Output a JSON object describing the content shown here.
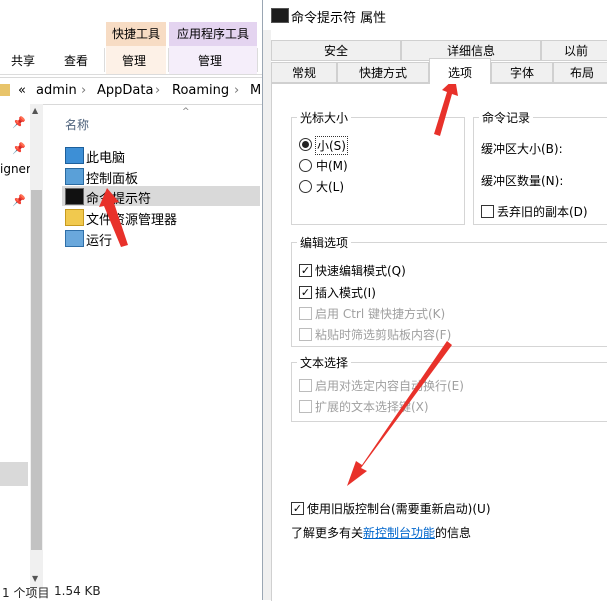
{
  "explorer": {
    "ribbon": {
      "context_tab_shortcut": "快捷工具",
      "context_tab_app": "应用程序工具",
      "share": "共享",
      "view": "查看",
      "manage_1": "管理",
      "manage_2": "管理"
    },
    "address": {
      "chevron": "«",
      "parts": [
        "admin",
        "AppData",
        "Roaming",
        "M"
      ],
      "separator": "›"
    },
    "nav_fragment": "igner",
    "column_header": "名称",
    "files": [
      {
        "name": "此电脑",
        "icon": "computer-icon"
      },
      {
        "name": "控制面板",
        "icon": "control-panel-icon"
      },
      {
        "name": "命令提示符",
        "icon": "cmd-icon",
        "selected": true
      },
      {
        "name": "文件资源管理器",
        "icon": "folder-icon"
      },
      {
        "name": "运行",
        "icon": "run-icon"
      }
    ],
    "status": {
      "count": "1 个项目",
      "size": "1.54 KB"
    }
  },
  "dialog": {
    "title": "命令提示符 属性",
    "tabs_row1": [
      "安全",
      "详细信息",
      "以前"
    ],
    "tabs_row2": [
      "常规",
      "快捷方式",
      "选项",
      "字体",
      "布局"
    ],
    "active_tab": "选项",
    "cursor_size": {
      "title": "光标大小",
      "options": [
        {
          "label": "小(S)",
          "checked": true
        },
        {
          "label": "中(M)",
          "checked": false
        },
        {
          "label": "大(L)",
          "checked": false
        }
      ]
    },
    "command_history": {
      "title": "命令记录",
      "buffer_size": "缓冲区大小(B):",
      "buffer_count": "缓冲区数量(N):",
      "discard_old": "丢弃旧的副本(D)",
      "discard_checked": false
    },
    "edit_options": {
      "title": "编辑选项",
      "items": [
        {
          "label": "快速编辑模式(Q)",
          "checked": true,
          "enabled": true
        },
        {
          "label": "插入模式(I)",
          "checked": true,
          "enabled": true
        },
        {
          "label": "启用 Ctrl 键快捷方式(K)",
          "checked": false,
          "enabled": false
        },
        {
          "label": "粘贴时筛选剪贴板内容(F)",
          "checked": false,
          "enabled": false
        }
      ]
    },
    "text_selection": {
      "title": "文本选择",
      "items": [
        {
          "label": "启用对选定内容自动换行(E)",
          "checked": false,
          "enabled": false
        },
        {
          "label": "扩展的文本选择键(X)",
          "checked": false,
          "enabled": false
        }
      ]
    },
    "legacy_console": {
      "label": "使用旧版控制台(需要重新启动)(U)",
      "checked": true
    },
    "learn_more": {
      "prefix": "了解更多有关",
      "link": "新控制台功能",
      "suffix": "的信息"
    }
  },
  "colors": {
    "ribbon_shortcut_tab": "#f7dcc4",
    "ribbon_app_tab": "#e4d4f0",
    "selection": "#d9d9d9",
    "annotation_arrow": "#e8312a",
    "link": "#0066cc"
  }
}
